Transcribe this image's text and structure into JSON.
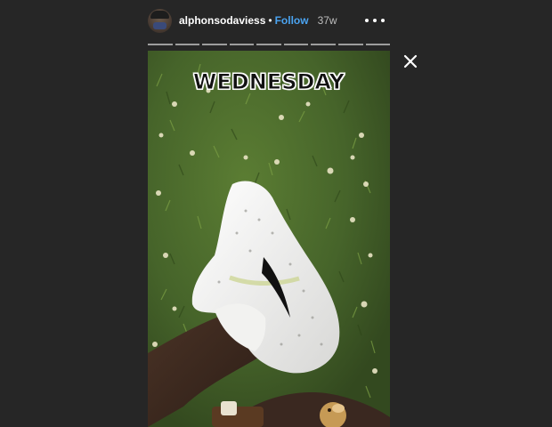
{
  "header": {
    "username": "alphonsodaviess",
    "separator": "•",
    "follow_label": "Follow",
    "time_ago": "37w"
  },
  "progress": {
    "segments": 9
  },
  "story": {
    "caption": "WEDNESDAY"
  },
  "icons": {
    "more": "more-options-icon",
    "close": "close-icon"
  },
  "colors": {
    "background": "#262626",
    "follow": "#4aa3f0",
    "username": "#ffffff"
  }
}
